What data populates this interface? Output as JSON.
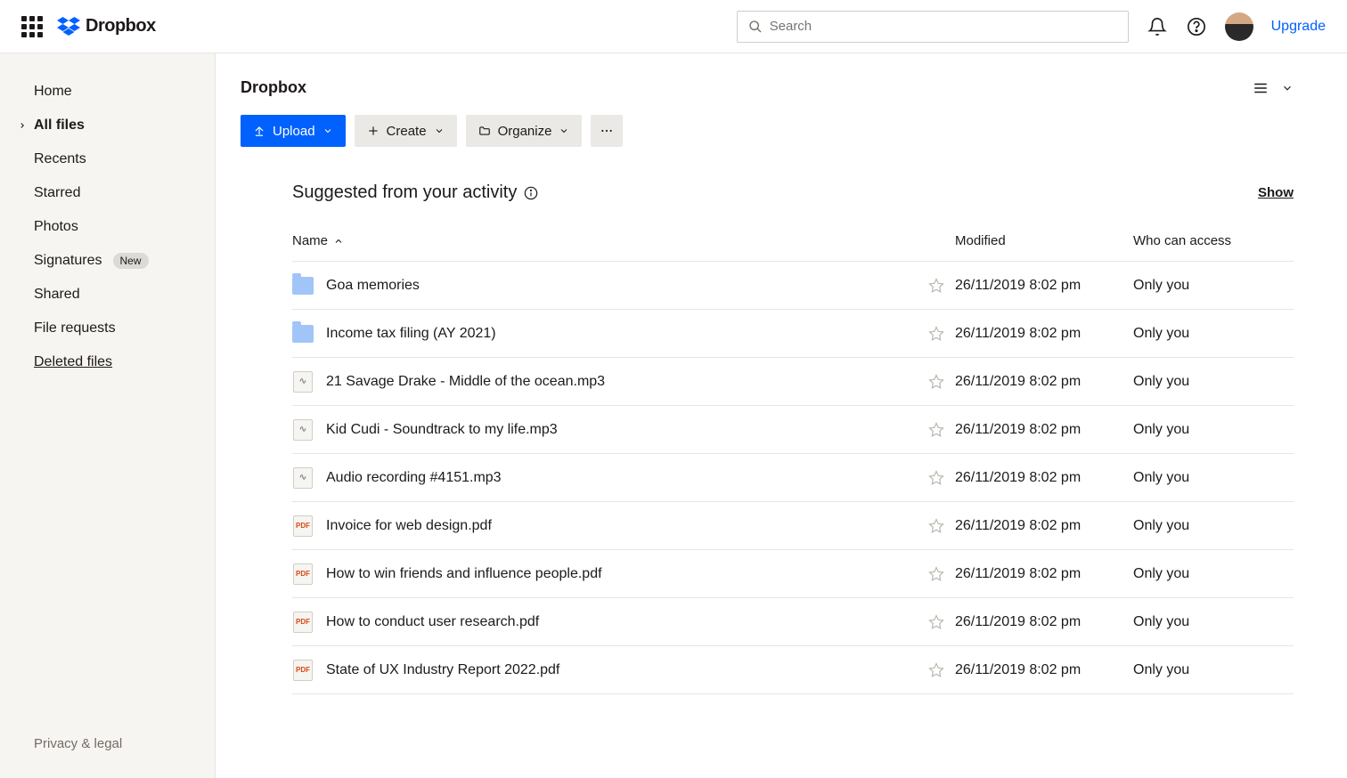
{
  "header": {
    "app_name": "Dropbox",
    "search_placeholder": "Search",
    "upgrade_label": "Upgrade"
  },
  "sidebar": {
    "items": [
      {
        "label": "Home",
        "active": false
      },
      {
        "label": "All files",
        "active": true,
        "expandable": true
      },
      {
        "label": "Recents"
      },
      {
        "label": "Starred"
      },
      {
        "label": "Photos"
      },
      {
        "label": "Signatures",
        "badge": "New"
      },
      {
        "label": "Shared"
      },
      {
        "label": "File requests"
      },
      {
        "label": "Deleted files",
        "underline": true
      }
    ],
    "footer": "Privacy & legal"
  },
  "main": {
    "breadcrumb": "Dropbox",
    "toolbar": {
      "upload": "Upload",
      "create": "Create",
      "organize": "Organize"
    },
    "suggested_title": "Suggested from your activity",
    "show_link": "Show",
    "columns": {
      "name": "Name",
      "modified": "Modified",
      "access": "Who can access"
    },
    "files": [
      {
        "icon": "folder",
        "name": "Goa memories",
        "modified": "26/11/2019 8:02 pm",
        "access": "Only you"
      },
      {
        "icon": "folder",
        "name": "Income tax filing (AY 2021)",
        "modified": "26/11/2019 8:02 pm",
        "access": "Only you"
      },
      {
        "icon": "audio",
        "name": "21 Savage Drake - Middle of the ocean.mp3",
        "modified": "26/11/2019 8:02 pm",
        "access": "Only you"
      },
      {
        "icon": "audio",
        "name": "Kid Cudi - Soundtrack to my life.mp3",
        "modified": "26/11/2019 8:02 pm",
        "access": "Only you"
      },
      {
        "icon": "audio",
        "name": "Audio recording #4151.mp3",
        "modified": "26/11/2019 8:02 pm",
        "access": "Only you"
      },
      {
        "icon": "pdf",
        "name": "Invoice for web design.pdf",
        "modified": "26/11/2019 8:02 pm",
        "access": "Only you"
      },
      {
        "icon": "pdf",
        "name": "How to win friends and influence people.pdf",
        "modified": "26/11/2019 8:02 pm",
        "access": "Only you"
      },
      {
        "icon": "pdf",
        "name": "How to conduct user research.pdf",
        "modified": "26/11/2019 8:02 pm",
        "access": "Only you"
      },
      {
        "icon": "pdf",
        "name": "State of UX Industry Report 2022.pdf",
        "modified": "26/11/2019 8:02 pm",
        "access": "Only you"
      }
    ]
  }
}
